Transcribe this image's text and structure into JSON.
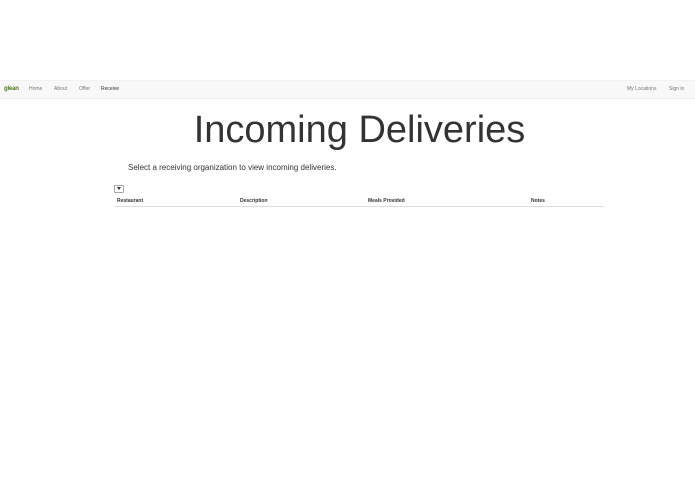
{
  "nav": {
    "brand": "glean",
    "left_items": [
      {
        "label": "Home",
        "active": false
      },
      {
        "label": "About",
        "active": false
      },
      {
        "label": "Offer",
        "active": false
      },
      {
        "label": "Receive",
        "active": true
      }
    ],
    "right_items": [
      {
        "label": "My Locations"
      },
      {
        "label": "Sign in"
      }
    ],
    "brand_color": "#4f7a1c"
  },
  "main": {
    "title": "Incoming Deliveries",
    "instruction": "Select a receiving organization to view incoming deliveries.",
    "organization_select": {
      "selected": ""
    },
    "table": {
      "columns": [
        "Restaurant",
        "Description",
        "Meals Provided",
        "Notes"
      ],
      "rows": []
    }
  }
}
